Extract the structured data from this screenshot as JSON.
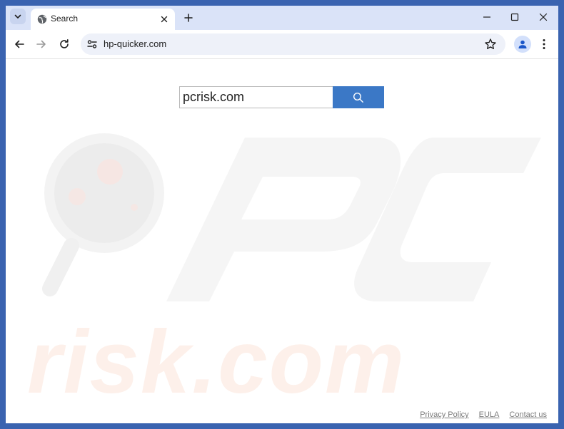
{
  "tab": {
    "title": "Search",
    "favicon_icon": "globe-icon"
  },
  "toolbar": {
    "url": "hp-quicker.com"
  },
  "search": {
    "value": "pcrisk.com",
    "button_icon": "search-icon"
  },
  "footer": {
    "links": [
      "Privacy Policy",
      "EULA",
      "Contact us"
    ]
  },
  "colors": {
    "frame": "#3a63b0",
    "tabstrip": "#dae3f8",
    "search_button": "#3b78c6"
  }
}
